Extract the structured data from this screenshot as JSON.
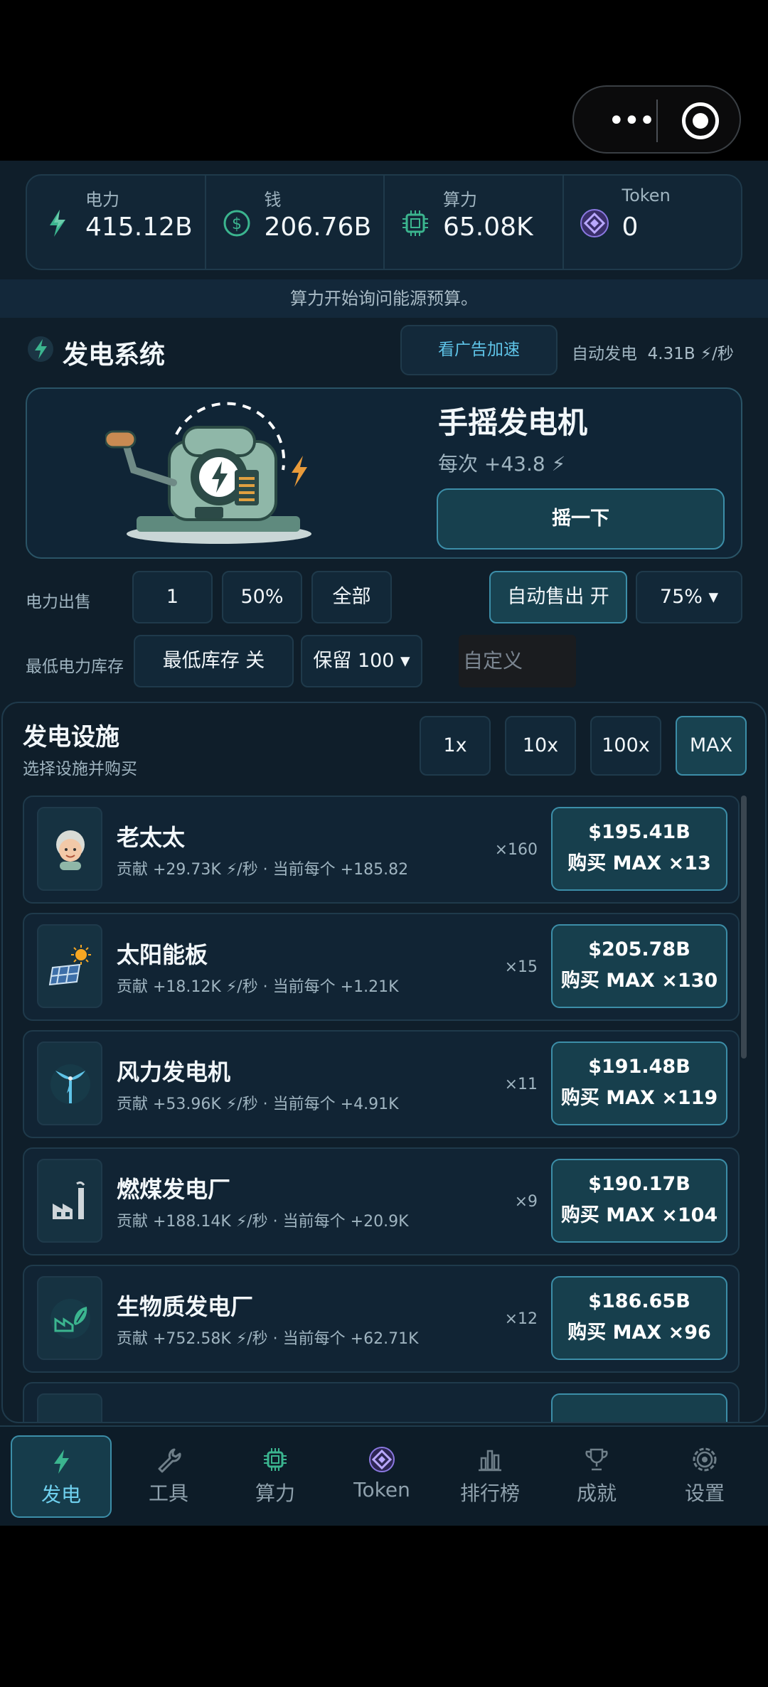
{
  "stats": [
    {
      "label": "电力",
      "value": "415.12B",
      "icon": "bolt-icon"
    },
    {
      "label": "钱",
      "value": "206.76B",
      "icon": "dollar-icon"
    },
    {
      "label": "算力",
      "value": "65.08K",
      "icon": "chip-icon"
    },
    {
      "label": "Token",
      "value": "0",
      "icon": "token-icon"
    }
  ],
  "notice": "算力开始询问能源预算。",
  "generator": {
    "title": "发电系统",
    "ad_button": "看广告加速",
    "auto_label": "自动发电",
    "auto_rate": "4.31B ⚡/秒",
    "crank_name": "手摇发电机",
    "crank_per": "每次 +43.8 ⚡",
    "crank_button": "摇一下"
  },
  "sell": {
    "label": "电力出售",
    "options": [
      "1",
      "50%",
      "全部"
    ],
    "auto_sell": "自动售出  开",
    "auto_pct": "75%  ▾"
  },
  "reserve": {
    "label": "最低电力库存",
    "toggle": "最低库存  关",
    "keep": "保留 100  ▾",
    "custom_placeholder": "自定义"
  },
  "facilities": {
    "title": "发电设施",
    "subtitle": "选择设施并购买",
    "quantities": [
      "1x",
      "10x",
      "100x",
      "MAX"
    ],
    "items": [
      {
        "name": "老太太",
        "desc": "贡献 +29.73K ⚡/秒 · 当前每个 +185.82",
        "count": "×160",
        "price": "$195.41B",
        "action": "购买 MAX ×13",
        "icon": "grandma-icon"
      },
      {
        "name": "太阳能板",
        "desc": "贡献 +18.12K ⚡/秒 · 当前每个 +1.21K",
        "count": "×15",
        "price": "$205.78B",
        "action": "购买 MAX ×130",
        "icon": "solar-panel-icon"
      },
      {
        "name": "风力发电机",
        "desc": "贡献 +53.96K ⚡/秒 · 当前每个 +4.91K",
        "count": "×11",
        "price": "$191.48B",
        "action": "购买 MAX ×119",
        "icon": "wind-turbine-icon"
      },
      {
        "name": "燃煤发电厂",
        "desc": "贡献 +188.14K ⚡/秒 · 当前每个 +20.9K",
        "count": "×9",
        "price": "$190.17B",
        "action": "购买 MAX ×104",
        "icon": "coal-plant-icon"
      },
      {
        "name": "生物质发电厂",
        "desc": "贡献 +752.58K ⚡/秒 · 当前每个 +62.71K",
        "count": "×12",
        "price": "$186.65B",
        "action": "购买 MAX ×96",
        "icon": "biomass-plant-icon"
      }
    ]
  },
  "nav": [
    {
      "label": "发电",
      "icon": "bolt-icon",
      "active": true
    },
    {
      "label": "工具",
      "icon": "wrench-icon"
    },
    {
      "label": "算力",
      "icon": "chip-icon"
    },
    {
      "label": "Token",
      "icon": "token-icon"
    },
    {
      "label": "排行榜",
      "icon": "chart-icon"
    },
    {
      "label": "成就",
      "icon": "trophy-icon"
    },
    {
      "label": "设置",
      "icon": "gear-icon"
    }
  ],
  "colors": {
    "accent": "#5fc4e8",
    "bolt": "#f0a030",
    "teal": "#3c8ea8",
    "background": "#0f1e2a"
  }
}
